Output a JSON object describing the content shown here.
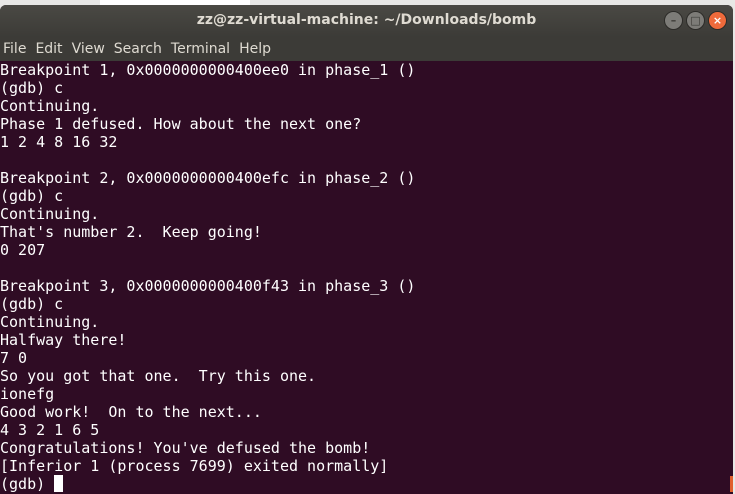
{
  "window": {
    "title": "zz@zz-virtual-machine: ~/Downloads/bomb"
  },
  "menu": [
    "File",
    "Edit",
    "View",
    "Search",
    "Terminal",
    "Help"
  ],
  "terminal": {
    "lines": [
      "Breakpoint 1, 0x0000000000400ee0 in phase_1 ()",
      "(gdb) c",
      "Continuing.",
      "Phase 1 defused. How about the next one?",
      "1 2 4 8 16 32",
      "",
      "Breakpoint 2, 0x0000000000400efc in phase_2 ()",
      "(gdb) c",
      "Continuing.",
      "That's number 2.  Keep going!",
      "0 207",
      "",
      "Breakpoint 3, 0x0000000000400f43 in phase_3 ()",
      "(gdb) c",
      "Continuing.",
      "Halfway there!",
      "7 0",
      "So you got that one.  Try this one.",
      "ionefg",
      "Good work!  On to the next...",
      "4 3 2 1 6 5",
      "Congratulations! You've defused the bomb!",
      "[Inferior 1 (process 7699) exited normally]"
    ],
    "prompt": "(gdb) "
  }
}
